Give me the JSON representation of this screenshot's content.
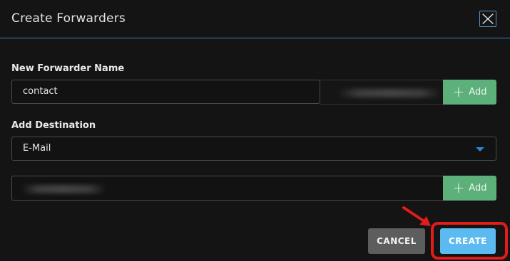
{
  "dialog": {
    "title": "Create Forwarders"
  },
  "forwarder_name": {
    "label": "New Forwarder Name",
    "value": "contact",
    "add_label": "Add"
  },
  "destination": {
    "label": "Add Destination",
    "type_selected": "E-Mail",
    "add_label": "Add"
  },
  "actions": {
    "cancel_label": "CANCEL",
    "create_label": "CREATE"
  },
  "colors": {
    "accent_blue": "#5bbaf0",
    "add_green": "#5db07a",
    "annotation_red": "#e21b1b"
  }
}
